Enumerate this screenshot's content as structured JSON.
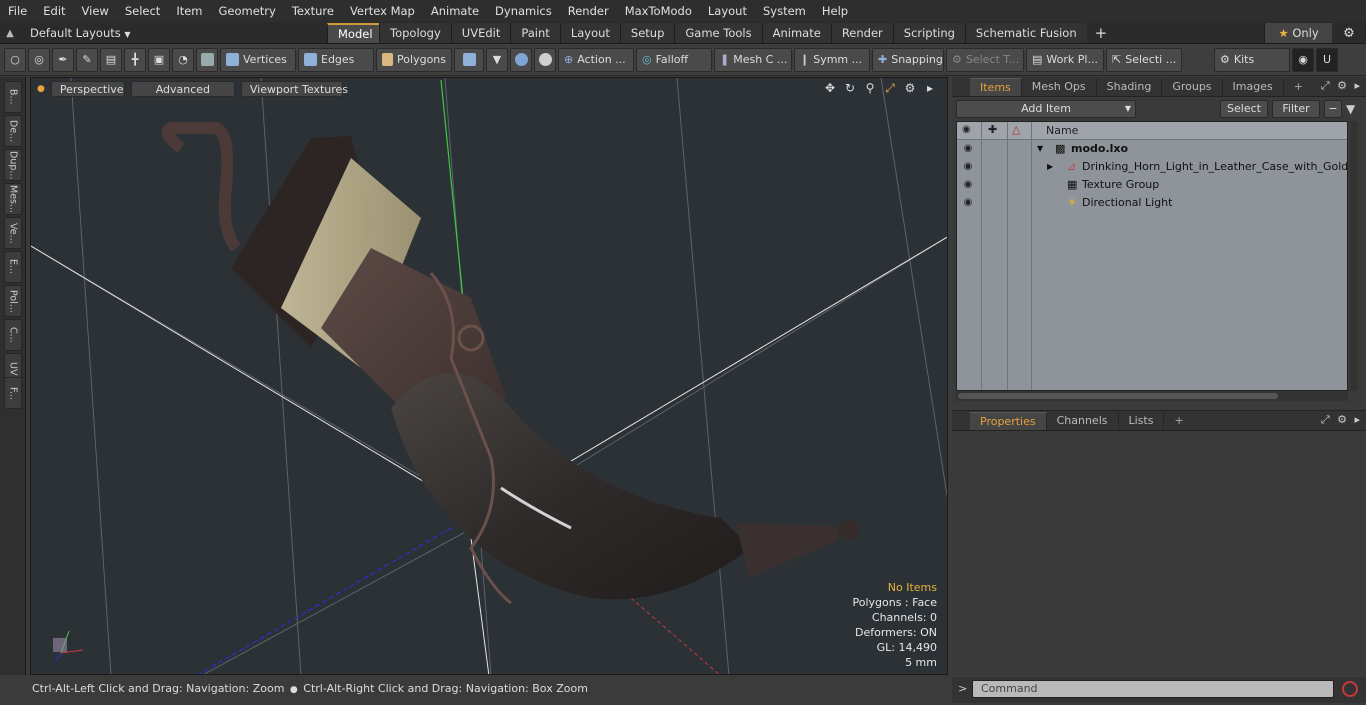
{
  "menu": [
    "File",
    "Edit",
    "View",
    "Select",
    "Item",
    "Geometry",
    "Texture",
    "Vertex Map",
    "Animate",
    "Dynamics",
    "Render",
    "MaxToModo",
    "Layout",
    "System",
    "Help"
  ],
  "layout_bar": {
    "layouts_label": "Default Layouts",
    "tabs": [
      "Model",
      "Topology",
      "UVEdit",
      "Paint",
      "Layout",
      "Setup",
      "Game Tools",
      "Animate",
      "Render",
      "Scripting",
      "Schematic Fusion"
    ],
    "active_tab": "Model",
    "only_label": "Only"
  },
  "toolbar": {
    "vertices": "Vertices",
    "edges": "Edges",
    "polygons": "Polygons",
    "action": "Action ...",
    "falloff": "Falloff",
    "mesh": "Mesh C ...",
    "symm": "Symm ...",
    "snapping": "Snapping",
    "select_t": "Select T...",
    "work_pl": "Work Pl...",
    "selecti": "Selecti ...",
    "kits": "Kits"
  },
  "left_strip": [
    "B...",
    "De...",
    "Dup...",
    "Mes...",
    "Ve...",
    "E...",
    "Pol...",
    "C...",
    "UV",
    "F..."
  ],
  "viewport": {
    "perspective": "Perspective",
    "advanced": "Advanced",
    "viewport_textures": "Viewport Textures",
    "info": {
      "no_items": "No Items",
      "polygons": "Polygons : Face",
      "channels": "Channels: 0",
      "deformers": "Deformers: ON",
      "gl": "GL: 14,490",
      "scale": "5 mm"
    },
    "colors": {
      "background": "#2c3136",
      "x_axis": "#c43a3a",
      "y_axis": "#3ec83e",
      "z_axis": "#2b2fcf"
    }
  },
  "status_bar": {
    "left": "Ctrl-Alt-Left Click and Drag: Navigation: Zoom",
    "right": "Ctrl-Alt-Right Click and Drag: Navigation: Box Zoom"
  },
  "items_panel": {
    "tabs": [
      "Items",
      "Mesh Ops",
      "Shading",
      "Groups",
      "Images"
    ],
    "active_tab": "Items",
    "add_item": "Add Item",
    "select": "Select",
    "filter": "Filter",
    "name_header": "Name",
    "tree": [
      {
        "label": "modo.lxo",
        "level": 0
      },
      {
        "label": "Drinking_Horn_Light_in_Leather_Case_with_Gold_Trim",
        "level": 1
      },
      {
        "label": "Texture Group",
        "level": 1
      },
      {
        "label": "Directional Light",
        "level": 1
      }
    ]
  },
  "properties_panel": {
    "tabs": [
      "Properties",
      "Channels",
      "Lists"
    ],
    "active_tab": "Properties"
  },
  "command": {
    "placeholder": "Command"
  }
}
